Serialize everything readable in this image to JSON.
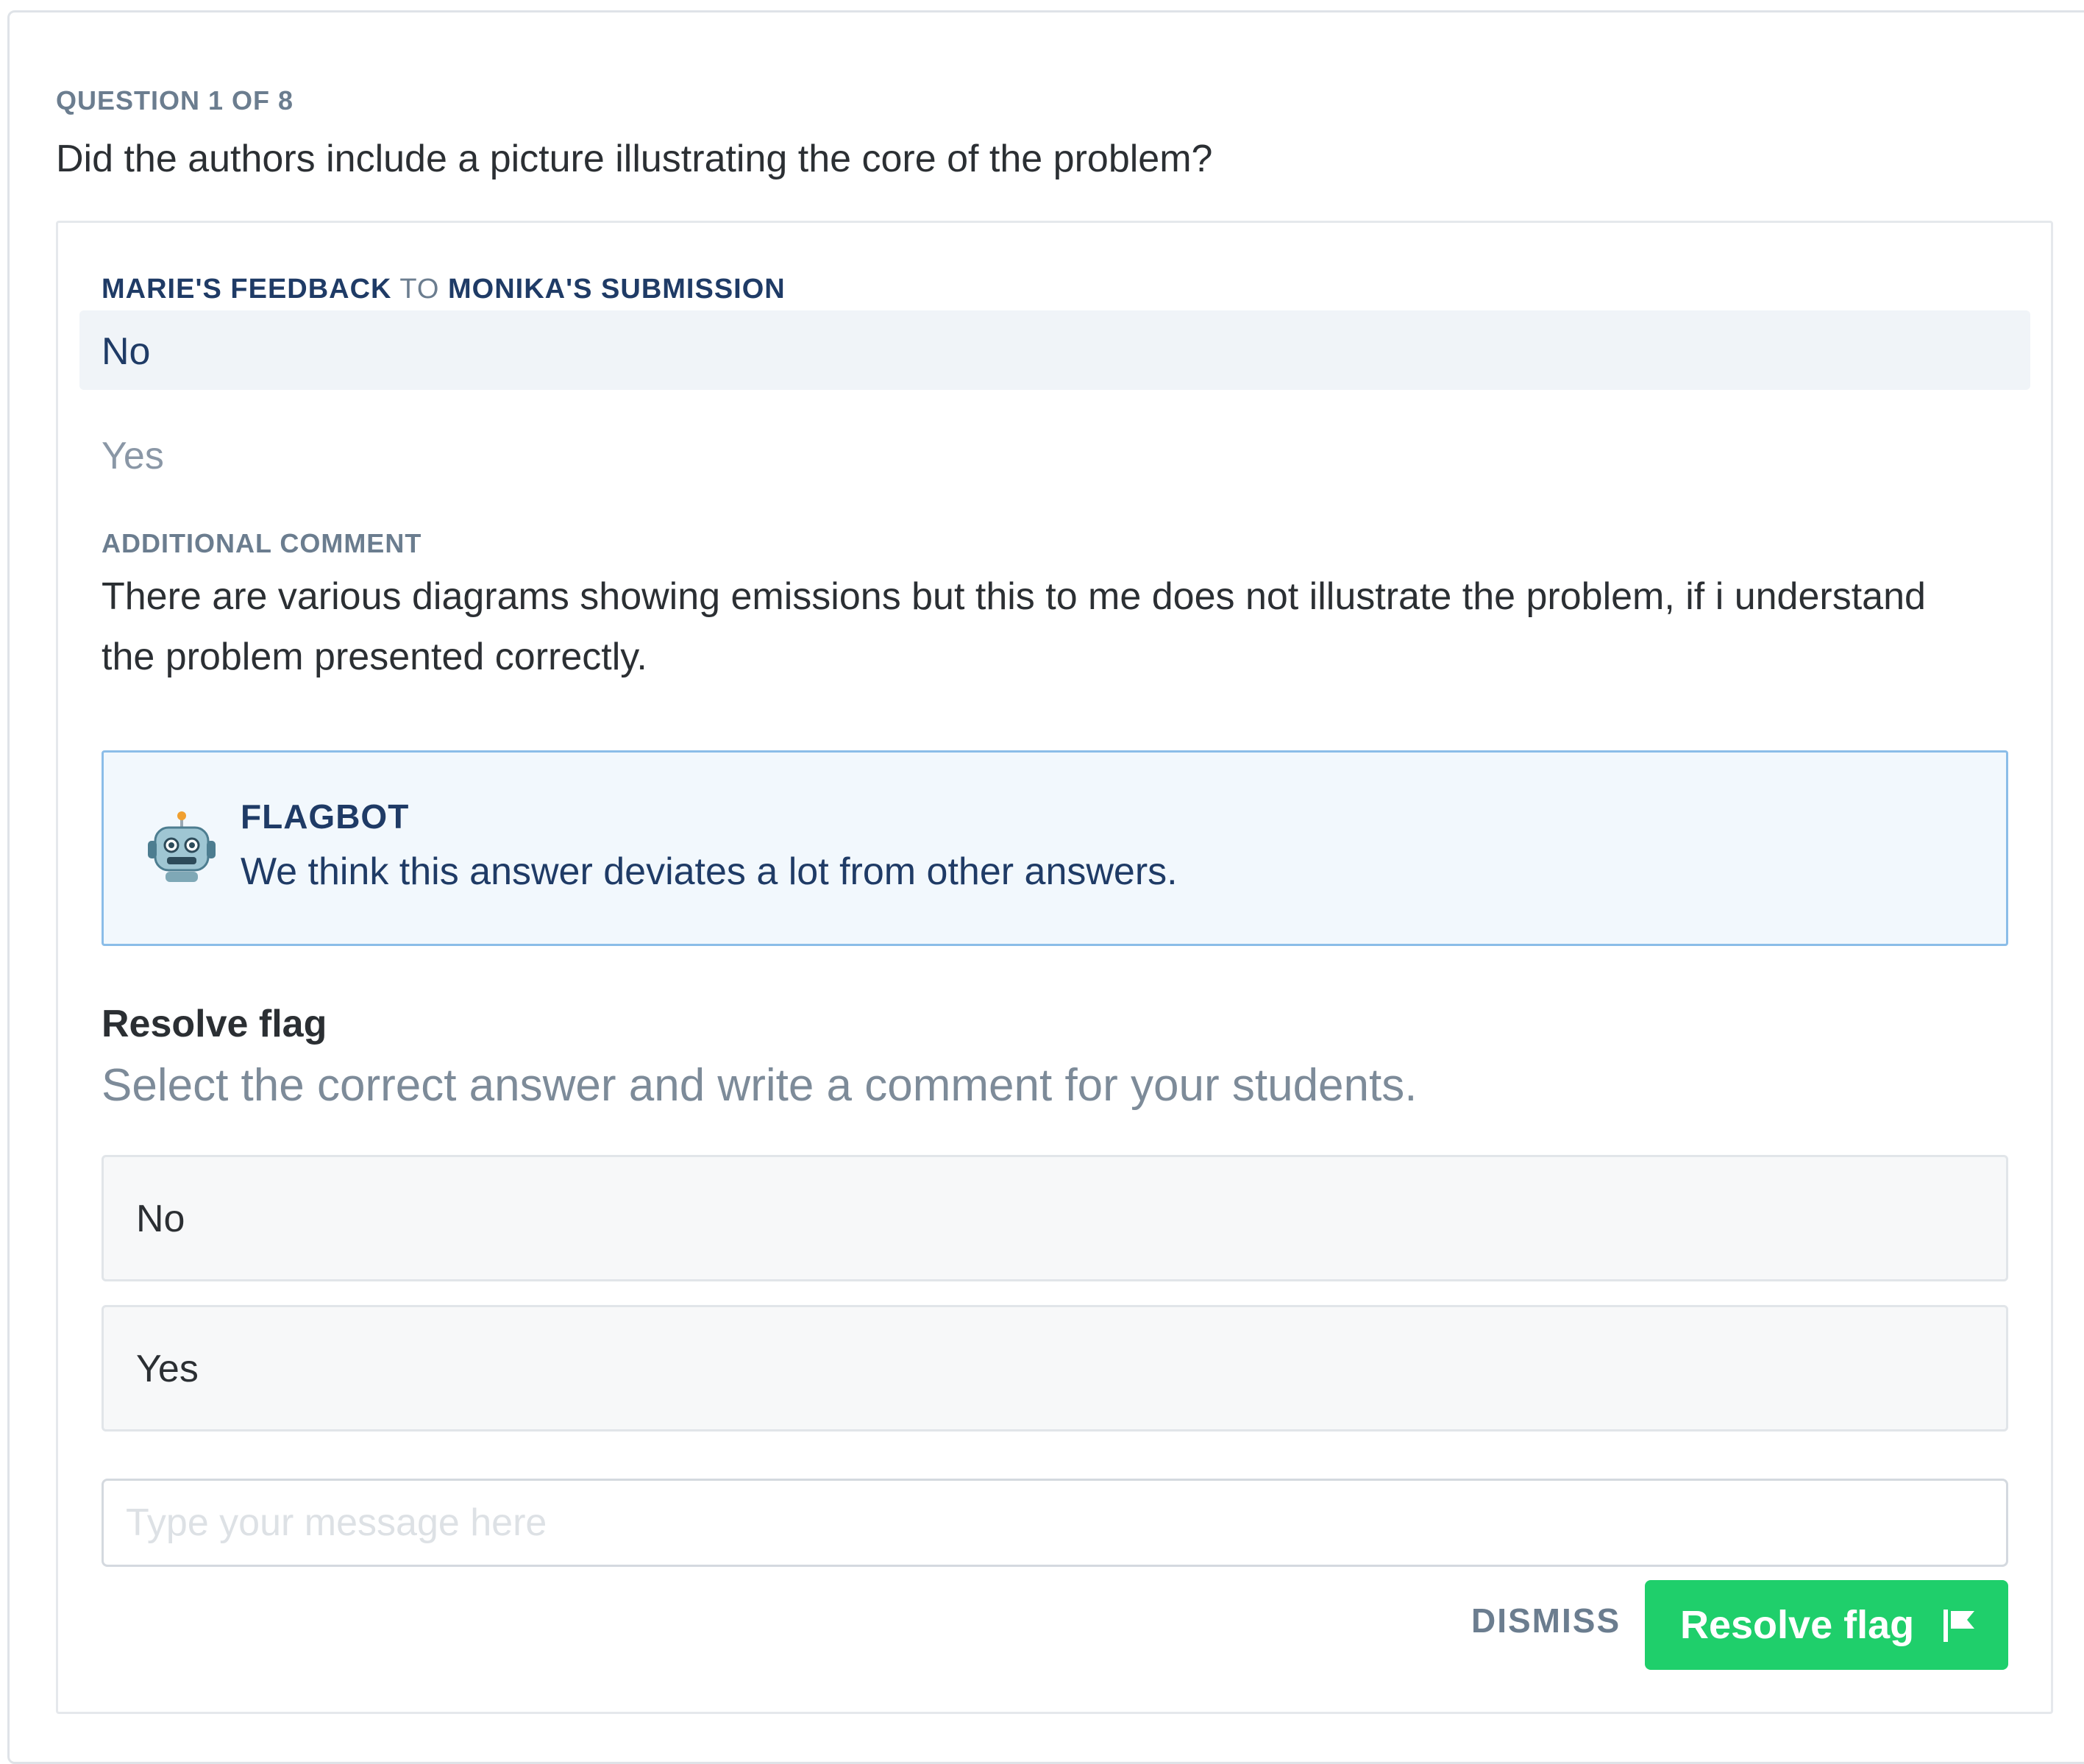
{
  "question": {
    "counter": "QUESTION 1 OF 8",
    "text": "Did the authors include a picture illustrating the core of the problem?"
  },
  "feedback": {
    "reviewer": "MARIE'S FEEDBACK",
    "connector": " TO ",
    "submission": "MONIKA'S SUBMISSION",
    "selected_answer": "No",
    "other_answer": "Yes",
    "comment_label": "ADDITIONAL COMMENT",
    "comment_text": "There are various diagrams showing emissions but this to me does not illustrate the problem, if i understand the problem presented correctly."
  },
  "flagbot": {
    "icon": "robot-icon",
    "title": "FLAGBOT",
    "message": "We think this answer deviates a lot from other answers."
  },
  "resolve": {
    "title": "Resolve flag",
    "subtitle": "Select the correct answer and write a comment for your students.",
    "options": [
      "No",
      "Yes"
    ],
    "message_placeholder": "Type your message here",
    "message_value": "",
    "dismiss_label": "DISMISS",
    "resolve_label": "Resolve flag",
    "resolve_icon": "flag-icon",
    "accent_color": "#1fcf6b"
  }
}
